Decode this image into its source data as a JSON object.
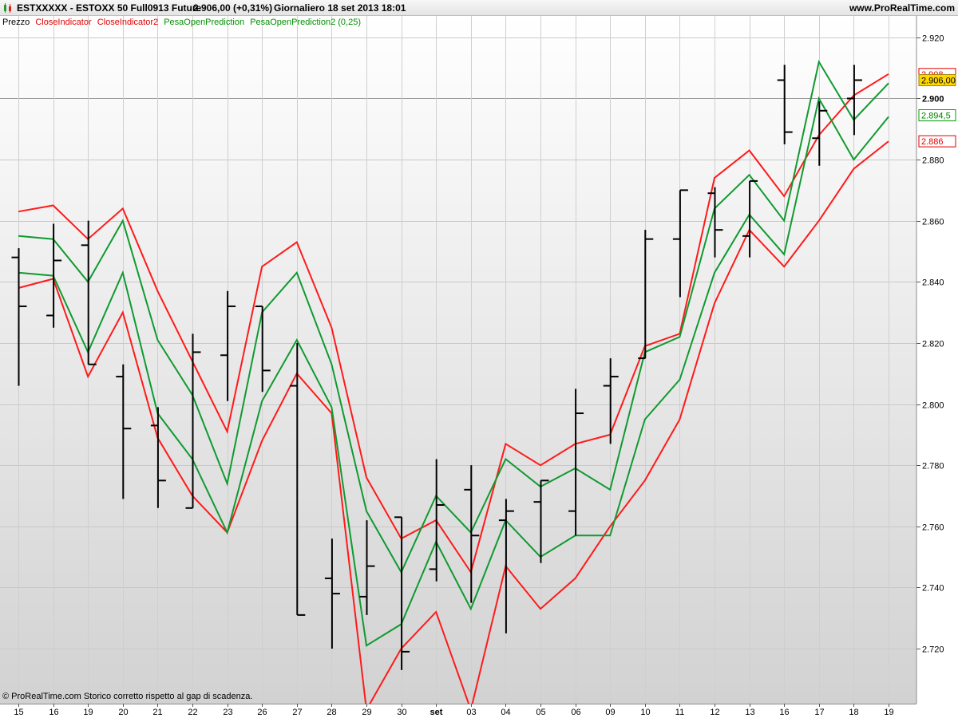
{
  "header": {
    "title": "ESTXXXXX - ESTOXX 50 Full0913 Future",
    "price": "2.906,00 (+0,31%)",
    "meta": "Giornaliero  18 set 2013 18:01",
    "site": "www.ProRealTime.com"
  },
  "legend": {
    "price_label": "Prezzo",
    "items": [
      {
        "label": "CloseIndicator",
        "color": "#e00000"
      },
      {
        "label": "CloseIndicator2",
        "color": "#e00000"
      },
      {
        "label": "PesaOpenPrediction",
        "color": "#00a000"
      },
      {
        "label": "PesaOpenPrediction2 (0,25)",
        "color": "#00a000"
      }
    ]
  },
  "footer": {
    "text": "© ProRealTime.com  Storico corretto rispetto al gap di scadenza."
  },
  "price_tags": [
    {
      "label": "2.906,00",
      "value": 2906,
      "bg": "#ffd700",
      "border": "#a08000",
      "fg": "#000"
    },
    {
      "label": "2.894,5",
      "value": 2894.5,
      "bg": "#ffffff",
      "border": "#00a000",
      "fg": "#008000"
    },
    {
      "label": "2.886",
      "value": 2886,
      "bg": "#ffffff",
      "border": "#e00000",
      "fg": "#e00000"
    },
    {
      "label": "2.908",
      "value": 2908,
      "bg": "#ffffff",
      "border": "#e00000",
      "fg": "#e00000"
    }
  ],
  "colors": {
    "red": "#ff1a1a",
    "green": "#109a30",
    "bars": "#000000"
  },
  "chart_data": {
    "type": "line",
    "y_ticks": [
      "2.920",
      "2.900",
      "2.880",
      "2.860",
      "2.840",
      "2.820",
      "2.800",
      "2.780",
      "2.760",
      "2.740",
      "2.720"
    ],
    "y_tick_values": [
      2920,
      2900,
      2880,
      2860,
      2840,
      2820,
      2800,
      2780,
      2760,
      2740,
      2720
    ],
    "ylim": [
      2702,
      2927
    ],
    "x_labels": [
      "15",
      "16",
      "19",
      "20",
      "21",
      "22",
      "23",
      "26",
      "27",
      "28",
      "29",
      "30",
      "set",
      "03",
      "04",
      "05",
      "06",
      "09",
      "10",
      "11",
      "12",
      "13",
      "16",
      "17",
      "18",
      "19"
    ],
    "ohlc": [
      {
        "o": 2848,
        "h": 2851,
        "l": 2806,
        "c": 2832
      },
      {
        "o": 2829,
        "h": 2859,
        "l": 2825,
        "c": 2847
      },
      {
        "o": 2852,
        "h": 2860,
        "l": 2813,
        "c": 2813
      },
      {
        "o": 2809,
        "h": 2813,
        "l": 2769,
        "c": 2792
      },
      {
        "o": 2793,
        "h": 2799,
        "l": 2766,
        "c": 2775
      },
      {
        "o": 2766,
        "h": 2823,
        "l": 2766,
        "c": 2817
      },
      {
        "o": 2816,
        "h": 2837,
        "l": 2801,
        "c": 2832
      },
      {
        "o": 2832,
        "h": 2832,
        "l": 2804,
        "c": 2811
      },
      {
        "o": 2806,
        "h": 2820,
        "l": 2731,
        "c": 2731
      },
      {
        "o": 2743,
        "h": 2756,
        "l": 2720,
        "c": 2738
      },
      {
        "o": 2737,
        "h": 2762,
        "l": 2731,
        "c": 2747
      },
      {
        "o": 2763,
        "h": 2763,
        "l": 2713,
        "c": 2719
      },
      {
        "o": 2746,
        "h": 2782,
        "l": 2742,
        "c": 2767
      },
      {
        "o": 2772,
        "h": 2780,
        "l": 2735,
        "c": 2757
      },
      {
        "o": 2762,
        "h": 2769,
        "l": 2725,
        "c": 2765
      },
      {
        "o": 2768,
        "h": 2775,
        "l": 2748,
        "c": 2775
      },
      {
        "o": 2765,
        "h": 2805,
        "l": 2757,
        "c": 2797
      },
      {
        "o": 2806,
        "h": 2815,
        "l": 2787,
        "c": 2809
      },
      {
        "o": 2815,
        "h": 2857,
        "l": 2815,
        "c": 2854
      },
      {
        "o": 2854,
        "h": 2870,
        "l": 2835,
        "c": 2870
      },
      {
        "o": 2869,
        "h": 2871,
        "l": 2848,
        "c": 2857
      },
      {
        "o": 2855,
        "h": 2873,
        "l": 2848,
        "c": 2873
      },
      {
        "o": 2906,
        "h": 2911,
        "l": 2885,
        "c": 2889
      },
      {
        "o": 2887,
        "h": 2899,
        "l": 2878,
        "c": 2896
      },
      {
        "o": 2900,
        "h": 2911,
        "l": 2888,
        "c": 2906
      }
    ],
    "series": [
      {
        "color": "red",
        "values": [
          2863,
          2865,
          2854,
          2864,
          2837,
          2814,
          2791,
          2845,
          2853,
          2825,
          2776,
          2756,
          2762,
          2745,
          2787,
          2780,
          2787,
          2790,
          2819,
          2823,
          2874,
          2883,
          2868,
          2888,
          2901,
          2908
        ]
      },
      {
        "color": "red",
        "values": [
          2838,
          2841,
          2809,
          2830,
          2789,
          2770,
          2758,
          2788,
          2810,
          2797,
          2700,
          2720,
          2732,
          2700,
          2747,
          2733,
          2743,
          2760,
          2775,
          2795,
          2833,
          2857,
          2845,
          2860,
          2877,
          2886
        ]
      },
      {
        "color": "green",
        "values": [
          2855,
          2854,
          2840,
          2860,
          2821,
          2803,
          2774,
          2830,
          2843,
          2813,
          2765,
          2745,
          2770,
          2758,
          2782,
          2773,
          2779,
          2772,
          2817,
          2822,
          2864,
          2875,
          2860,
          2912,
          2893,
          2905
        ]
      },
      {
        "color": "green",
        "values": [
          2843,
          2842,
          2817,
          2843,
          2797,
          2782,
          2758,
          2801,
          2821,
          2799,
          2721,
          2728,
          2755,
          2733,
          2762,
          2750,
          2757,
          2757,
          2795,
          2808,
          2843,
          2862,
          2849,
          2900,
          2880,
          2894
        ]
      }
    ]
  }
}
